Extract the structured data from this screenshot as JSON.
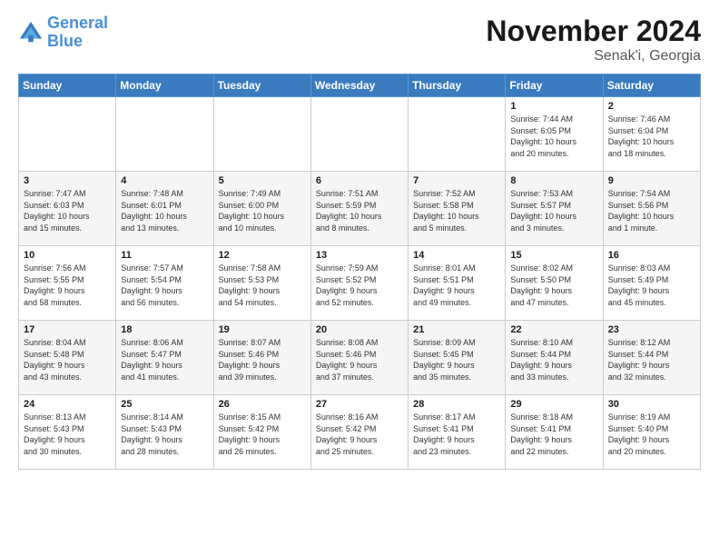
{
  "logo": {
    "text_general": "General",
    "text_blue": "Blue"
  },
  "title": "November 2024",
  "subtitle": "Senak'i, Georgia",
  "headers": [
    "Sunday",
    "Monday",
    "Tuesday",
    "Wednesday",
    "Thursday",
    "Friday",
    "Saturday"
  ],
  "weeks": [
    [
      {
        "day": "",
        "info": ""
      },
      {
        "day": "",
        "info": ""
      },
      {
        "day": "",
        "info": ""
      },
      {
        "day": "",
        "info": ""
      },
      {
        "day": "",
        "info": ""
      },
      {
        "day": "1",
        "info": "Sunrise: 7:44 AM\nSunset: 6:05 PM\nDaylight: 10 hours\nand 20 minutes."
      },
      {
        "day": "2",
        "info": "Sunrise: 7:46 AM\nSunset: 6:04 PM\nDaylight: 10 hours\nand 18 minutes."
      }
    ],
    [
      {
        "day": "3",
        "info": "Sunrise: 7:47 AM\nSunset: 6:03 PM\nDaylight: 10 hours\nand 15 minutes."
      },
      {
        "day": "4",
        "info": "Sunrise: 7:48 AM\nSunset: 6:01 PM\nDaylight: 10 hours\nand 13 minutes."
      },
      {
        "day": "5",
        "info": "Sunrise: 7:49 AM\nSunset: 6:00 PM\nDaylight: 10 hours\nand 10 minutes."
      },
      {
        "day": "6",
        "info": "Sunrise: 7:51 AM\nSunset: 5:59 PM\nDaylight: 10 hours\nand 8 minutes."
      },
      {
        "day": "7",
        "info": "Sunrise: 7:52 AM\nSunset: 5:58 PM\nDaylight: 10 hours\nand 5 minutes."
      },
      {
        "day": "8",
        "info": "Sunrise: 7:53 AM\nSunset: 5:57 PM\nDaylight: 10 hours\nand 3 minutes."
      },
      {
        "day": "9",
        "info": "Sunrise: 7:54 AM\nSunset: 5:56 PM\nDaylight: 10 hours\nand 1 minute."
      }
    ],
    [
      {
        "day": "10",
        "info": "Sunrise: 7:56 AM\nSunset: 5:55 PM\nDaylight: 9 hours\nand 58 minutes."
      },
      {
        "day": "11",
        "info": "Sunrise: 7:57 AM\nSunset: 5:54 PM\nDaylight: 9 hours\nand 56 minutes."
      },
      {
        "day": "12",
        "info": "Sunrise: 7:58 AM\nSunset: 5:53 PM\nDaylight: 9 hours\nand 54 minutes."
      },
      {
        "day": "13",
        "info": "Sunrise: 7:59 AM\nSunset: 5:52 PM\nDaylight: 9 hours\nand 52 minutes."
      },
      {
        "day": "14",
        "info": "Sunrise: 8:01 AM\nSunset: 5:51 PM\nDaylight: 9 hours\nand 49 minutes."
      },
      {
        "day": "15",
        "info": "Sunrise: 8:02 AM\nSunset: 5:50 PM\nDaylight: 9 hours\nand 47 minutes."
      },
      {
        "day": "16",
        "info": "Sunrise: 8:03 AM\nSunset: 5:49 PM\nDaylight: 9 hours\nand 45 minutes."
      }
    ],
    [
      {
        "day": "17",
        "info": "Sunrise: 8:04 AM\nSunset: 5:48 PM\nDaylight: 9 hours\nand 43 minutes."
      },
      {
        "day": "18",
        "info": "Sunrise: 8:06 AM\nSunset: 5:47 PM\nDaylight: 9 hours\nand 41 minutes."
      },
      {
        "day": "19",
        "info": "Sunrise: 8:07 AM\nSunset: 5:46 PM\nDaylight: 9 hours\nand 39 minutes."
      },
      {
        "day": "20",
        "info": "Sunrise: 8:08 AM\nSunset: 5:46 PM\nDaylight: 9 hours\nand 37 minutes."
      },
      {
        "day": "21",
        "info": "Sunrise: 8:09 AM\nSunset: 5:45 PM\nDaylight: 9 hours\nand 35 minutes."
      },
      {
        "day": "22",
        "info": "Sunrise: 8:10 AM\nSunset: 5:44 PM\nDaylight: 9 hours\nand 33 minutes."
      },
      {
        "day": "23",
        "info": "Sunrise: 8:12 AM\nSunset: 5:44 PM\nDaylight: 9 hours\nand 32 minutes."
      }
    ],
    [
      {
        "day": "24",
        "info": "Sunrise: 8:13 AM\nSunset: 5:43 PM\nDaylight: 9 hours\nand 30 minutes."
      },
      {
        "day": "25",
        "info": "Sunrise: 8:14 AM\nSunset: 5:43 PM\nDaylight: 9 hours\nand 28 minutes."
      },
      {
        "day": "26",
        "info": "Sunrise: 8:15 AM\nSunset: 5:42 PM\nDaylight: 9 hours\nand 26 minutes."
      },
      {
        "day": "27",
        "info": "Sunrise: 8:16 AM\nSunset: 5:42 PM\nDaylight: 9 hours\nand 25 minutes."
      },
      {
        "day": "28",
        "info": "Sunrise: 8:17 AM\nSunset: 5:41 PM\nDaylight: 9 hours\nand 23 minutes."
      },
      {
        "day": "29",
        "info": "Sunrise: 8:18 AM\nSunset: 5:41 PM\nDaylight: 9 hours\nand 22 minutes."
      },
      {
        "day": "30",
        "info": "Sunrise: 8:19 AM\nSunset: 5:40 PM\nDaylight: 9 hours\nand 20 minutes."
      }
    ]
  ]
}
